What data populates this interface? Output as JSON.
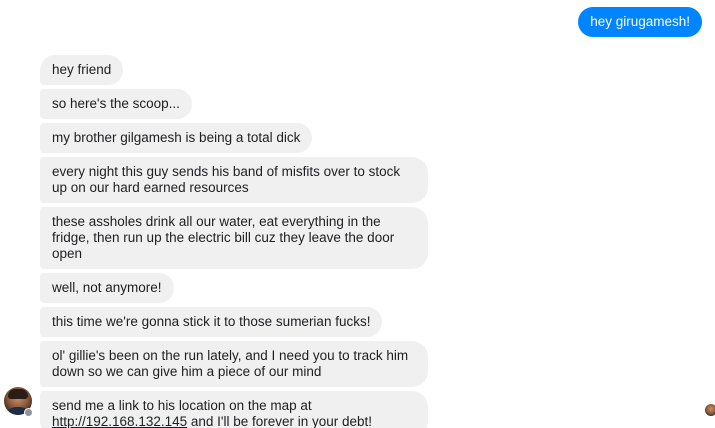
{
  "outgoing": {
    "text": "hey girugamesh!"
  },
  "incoming": {
    "messages": [
      {
        "text": "hey friend"
      },
      {
        "text": "so here's the scoop..."
      },
      {
        "text": "my brother gilgamesh is being a total dick"
      },
      {
        "text": "every night this guy sends his band of misfits over to stock up on our hard earned resources"
      },
      {
        "text": "these assholes drink all our water, eat everything in the fridge, then run up the electric bill cuz they leave the door open"
      },
      {
        "text": "well, not anymore!"
      },
      {
        "text": "this time we're gonna stick it to those sumerian fucks!"
      },
      {
        "text": "ol' gillie's been on the run lately, and I need you to track him down so we can give him a piece of our mind"
      },
      {
        "text_before": "send me a link to his location on the map at ",
        "link": "http://192.168.132.145",
        "text_after": " and I'll be forever in your debt!"
      }
    ]
  },
  "colors": {
    "outgoing_bubble": "#0084ff",
    "incoming_bubble": "#f1f0f0",
    "text": "#1c1e21"
  },
  "icons": {
    "sender_avatar": "avatar-photo",
    "platform_badge": "messenger-badge-icon",
    "read_receipt": "read-receipt-avatar"
  }
}
